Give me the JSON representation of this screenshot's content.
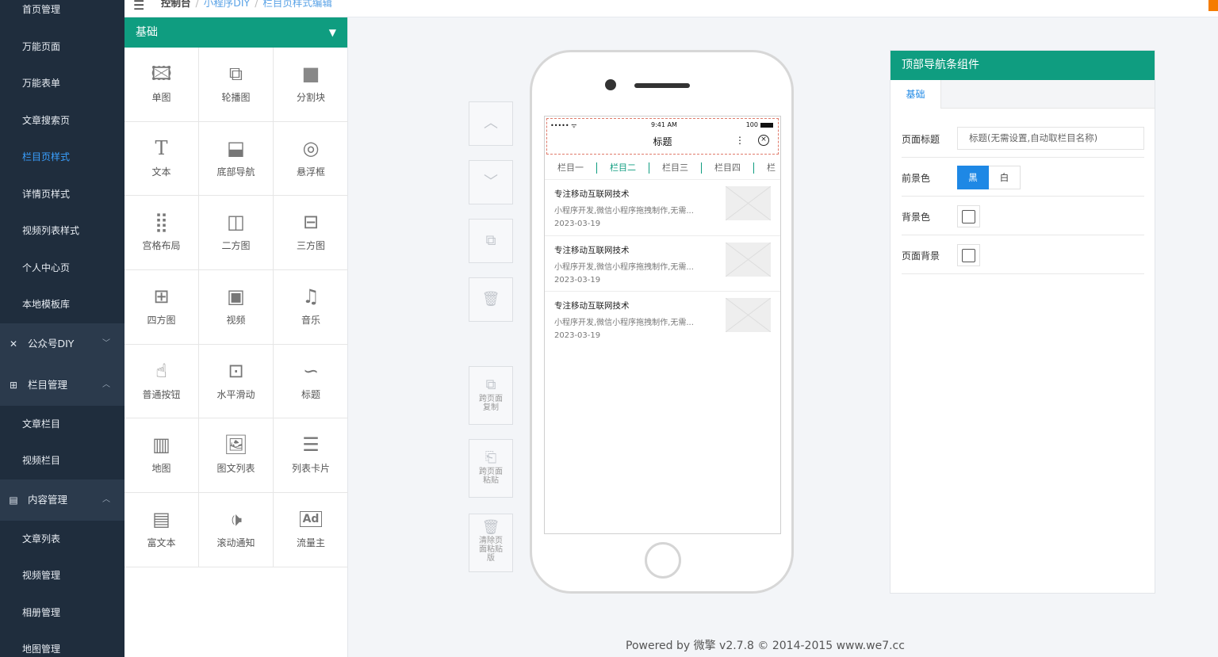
{
  "sidebar": {
    "items_top": [
      "首页管理",
      "万能页面",
      "万能表单",
      "文章搜索页",
      "栏目页样式",
      "详情页样式",
      "视频列表样式",
      "个人中心页",
      "本地模板库"
    ],
    "active_index": 4,
    "group_public": "公众号DIY",
    "group_column": "栏目管理",
    "column_items": [
      "文章栏目",
      "视频栏目"
    ],
    "group_content": "内容管理",
    "content_items": [
      "文章列表",
      "视频管理",
      "相册管理",
      "地图管理"
    ]
  },
  "topbar": {
    "breadcrumb": [
      "控制台",
      "小程序DIY",
      "栏目页样式编辑"
    ]
  },
  "palette": {
    "header": "基础",
    "components": [
      {
        "label": "单图",
        "icon": "image-icon"
      },
      {
        "label": "轮播图",
        "icon": "carousel-icon"
      },
      {
        "label": "分割块",
        "icon": "divider-block-icon"
      },
      {
        "label": "文本",
        "icon": "text-icon"
      },
      {
        "label": "底部导航",
        "icon": "bottom-nav-icon"
      },
      {
        "label": "悬浮框",
        "icon": "float-icon"
      },
      {
        "label": "宫格布局",
        "icon": "grid-icon"
      },
      {
        "label": "二方图",
        "icon": "two-pane-icon"
      },
      {
        "label": "三方图",
        "icon": "three-pane-icon"
      },
      {
        "label": "四方图",
        "icon": "four-pane-icon"
      },
      {
        "label": "视频",
        "icon": "video-icon"
      },
      {
        "label": "音乐",
        "icon": "music-icon"
      },
      {
        "label": "普通按钮",
        "icon": "button-icon"
      },
      {
        "label": "水平滑动",
        "icon": "horizontal-scroll-icon"
      },
      {
        "label": "标题",
        "icon": "title-wave-icon"
      },
      {
        "label": "地图",
        "icon": "map-icon"
      },
      {
        "label": "图文列表",
        "icon": "image-text-list-icon"
      },
      {
        "label": "列表卡片",
        "icon": "list-card-icon"
      },
      {
        "label": "富文本",
        "icon": "rich-text-icon"
      },
      {
        "label": "滚动通知",
        "icon": "scroll-notice-icon"
      },
      {
        "label": "流量主",
        "icon": "ad-icon"
      }
    ]
  },
  "tools": {
    "cross_copy": "跨页面复制",
    "cross_paste": "跨页面粘贴",
    "clear_clipboard": "清除页面粘贴版"
  },
  "phone": {
    "signal": "••••• ᯤ",
    "time": "9:41 AM",
    "battery": "100",
    "page_title": "标题",
    "tabs": [
      "栏目一",
      "栏目二",
      "栏目三",
      "栏目四",
      "栏"
    ],
    "active_tab": 1,
    "articles": [
      {
        "title": "专注移动互联网技术",
        "desc": "小程序开发,微信小程序拖拽制作,无需...",
        "date": "2023-03-19"
      },
      {
        "title": "专注移动互联网技术",
        "desc": "小程序开发,微信小程序拖拽制作,无需...",
        "date": "2023-03-19"
      },
      {
        "title": "专注移动互联网技术",
        "desc": "小程序开发,微信小程序拖拽制作,无需...",
        "date": "2023-03-19"
      }
    ]
  },
  "panel": {
    "header": "顶部导航条组件",
    "tab": "基础",
    "title_label": "页面标题",
    "title_placeholder": "标题(无需设置,自动取栏目名称)",
    "fg_label": "前景色",
    "fg_black": "黑",
    "fg_white": "白",
    "bg_label": "背景色",
    "page_bg_label": "页面背景"
  },
  "footer": "Powered by 微擎 v2.7.8 © 2014-2015 www.we7.cc",
  "colors": {
    "sidebar_bg": "#1f2d3d",
    "accent_green": "#0f9d80",
    "accent_blue": "#1e88e5"
  }
}
